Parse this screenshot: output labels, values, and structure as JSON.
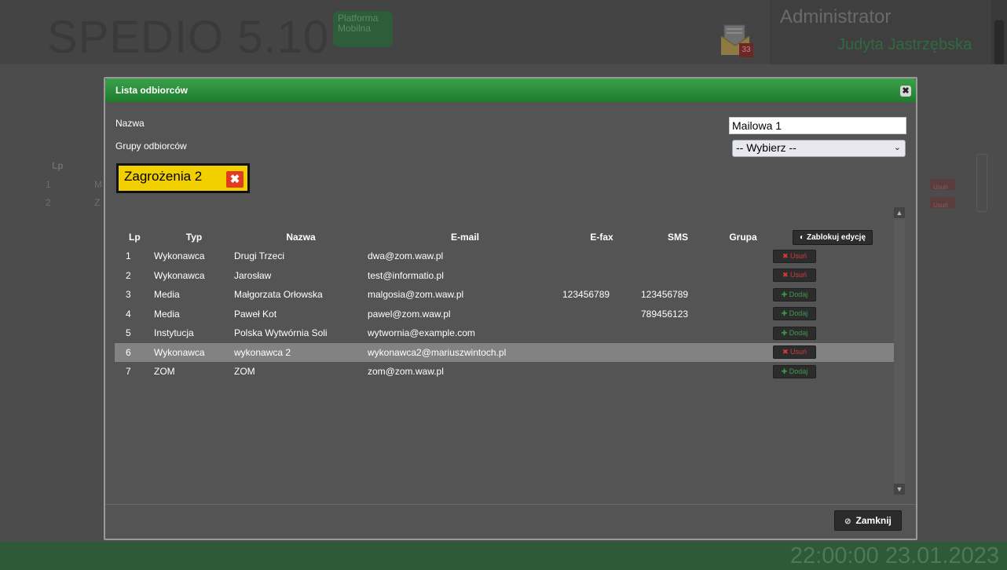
{
  "app": {
    "logo": "SPEDIO 5.10",
    "platform_badge": "Platforma\nMobilna",
    "mail_count": "33",
    "user_role": "Administrator",
    "user_name": "Judyta Jastrzębska",
    "clock": "22:00:00 23.01.2023",
    "bg_table": {
      "lp_header": "Lp",
      "row1_lp": "1",
      "row2_lp": "2",
      "row1_c": "M",
      "row2_c": "Z"
    },
    "bg_actions": {
      "row1": "Usuń",
      "row2": "Usuń"
    }
  },
  "modal": {
    "title": "Lista odbiorców",
    "close_glyph": "✖",
    "name_label": "Nazwa",
    "name_value": "Mailowa 1",
    "groups_label": "Grupy odbiorców",
    "groups_select": "-- Wybierz --",
    "selected_group": "Zagrożenia 2",
    "remove_glyph": "✖",
    "close_button": "Zamknij"
  },
  "table": {
    "headers": {
      "lp": "Lp",
      "typ": "Typ",
      "nazwa": "Nazwa",
      "email": "E-mail",
      "efax": "E-fax",
      "sms": "SMS",
      "grupa": "Grupa",
      "lock": "Zablokuj edycję"
    },
    "rows": [
      {
        "lp": "1",
        "typ": "Wykonawca",
        "nazwa": "Drugi Trzeci",
        "email": "dwa@zom.waw.pl",
        "efax": "",
        "sms": "",
        "grupa": "",
        "action": "Usuń"
      },
      {
        "lp": "2",
        "typ": "Wykonawca",
        "nazwa": "Jarosław",
        "email": "test@informatio.pl",
        "efax": "",
        "sms": "",
        "grupa": "",
        "action": "Usuń"
      },
      {
        "lp": "3",
        "typ": "Media",
        "nazwa": "Małgorzata Orłowska",
        "email": "malgosia@zom.waw.pl",
        "efax": "123456789",
        "sms": "123456789",
        "grupa": "",
        "action": "Dodaj"
      },
      {
        "lp": "4",
        "typ": "Media",
        "nazwa": "Paweł Kot",
        "email": "pawel@zom.waw.pl",
        "efax": "",
        "sms": "789456123",
        "grupa": "",
        "action": "Dodaj"
      },
      {
        "lp": "5",
        "typ": "Instytucja",
        "nazwa": "Polska Wytwórnia Soli",
        "email": "wytwornia@example.com",
        "efax": "",
        "sms": "",
        "grupa": "",
        "action": "Dodaj"
      },
      {
        "lp": "6",
        "typ": "Wykonawca",
        "nazwa": "wykonawca 2",
        "email": "wykonawca2@mariuszwintoch.pl",
        "efax": "",
        "sms": "",
        "grupa": "",
        "action": "Usuń"
      },
      {
        "lp": "7",
        "typ": "ZOM",
        "nazwa": "ZOM",
        "email": "zom@zom.waw.pl",
        "efax": "",
        "sms": "",
        "grupa": "",
        "action": "Dodaj"
      }
    ]
  }
}
